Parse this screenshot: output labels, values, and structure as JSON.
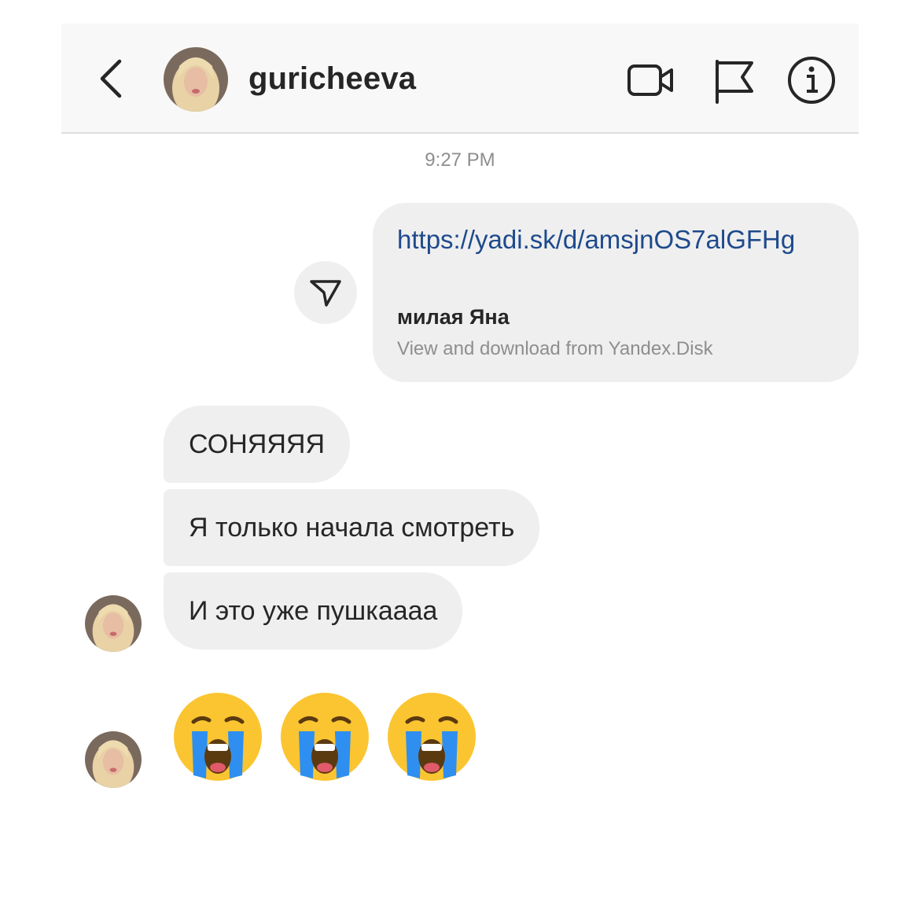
{
  "header": {
    "username": "guricheeva",
    "icons": [
      "back-chevron-icon",
      "avatar",
      "video-call-icon",
      "flag-icon",
      "info-icon"
    ]
  },
  "chat": {
    "timestamp": "9:27 PM",
    "link_message": {
      "url": "https://yadi.sk/d/amsjnOS7alGFHg",
      "title": "милая Яна",
      "subtitle": "View and download from Yandex.Disk"
    },
    "incoming": [
      {
        "text": "СОНЯЯЯЯ"
      },
      {
        "text": "Я только начала смотреть"
      },
      {
        "text": "И это уже пушкаааа"
      }
    ],
    "emoji_message": [
      "loudly-crying-face",
      "loudly-crying-face",
      "loudly-crying-face"
    ]
  },
  "colors": {
    "link": "#1e4a8c",
    "bubble": "#efefef",
    "header_bg": "#f8f8f8",
    "muted_text": "#8e8e8e"
  }
}
